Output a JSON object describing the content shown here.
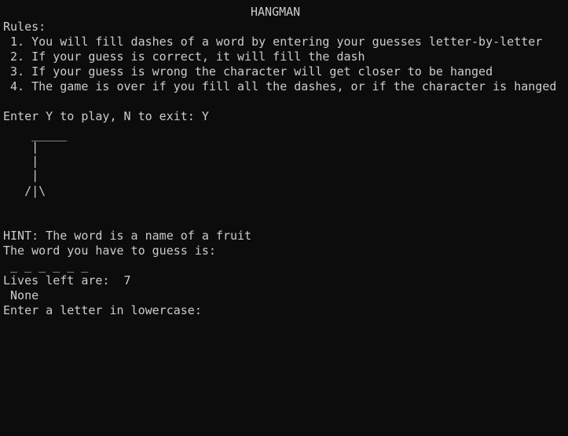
{
  "window": {
    "title": "HANGMAN"
  },
  "rules": {
    "heading": "Rules:",
    "items": [
      " 1. You will fill dashes of a word by entering your guesses letter-by-letter",
      " 2. If your guess is correct, it will fill the dash",
      " 3. If your guess is wrong the character will get closer to be hanged",
      " 4. The game is over if you fill all the dashes, or if the character is hanged"
    ]
  },
  "prompt_play": "Enter Y to play, N to exit: Y",
  "gallows": [
    "    _____",
    "    |",
    "    |",
    "    |",
    "   /|\\"
  ],
  "hint": "HINT: The word is a name of a fruit",
  "word_prompt": "The word you have to guess is:",
  "word_dashes": " _ _ _ _ _ _",
  "lives": "Lives left are:  7",
  "guessed": " None",
  "input_prompt": "Enter a letter in lowercase:"
}
